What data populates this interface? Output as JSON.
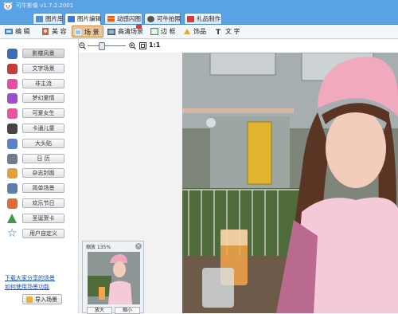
{
  "app": {
    "title": "可牛影像 v1.7.2.2001"
  },
  "tabs": [
    {
      "label": "图片库",
      "icon": "image-library-icon"
    },
    {
      "label": "图片编辑",
      "icon": "image-edit-icon"
    },
    {
      "label": "动感闪图",
      "icon": "flash-image-icon"
    },
    {
      "label": "可牛拍照",
      "icon": "camera-icon"
    },
    {
      "label": "礼品制作",
      "icon": "gift-icon"
    }
  ],
  "toolbar": [
    {
      "label": "编 辑",
      "icon": "edit-icon"
    },
    {
      "label": "美 容",
      "icon": "beauty-icon"
    },
    {
      "label": "场 景",
      "icon": "scene-icon"
    },
    {
      "label": "高清场景",
      "icon": "hd-scene-icon"
    },
    {
      "label": "边 框",
      "icon": "frame-icon"
    },
    {
      "label": "饰品",
      "icon": "accessory-icon"
    },
    {
      "label": "文 字",
      "icon": "text-icon"
    }
  ],
  "categories": [
    {
      "label": "影楼风景",
      "icon": "portrait-icon"
    },
    {
      "label": "文字场景",
      "icon": "text-scene-icon"
    },
    {
      "label": "非主流",
      "icon": "sparkle-icon"
    },
    {
      "label": "梦幻爱情",
      "icon": "heart-icon"
    },
    {
      "label": "可爱女生",
      "icon": "girl-icon"
    },
    {
      "label": "卡通儿童",
      "icon": "cartoon-icon"
    },
    {
      "label": "大头贴",
      "icon": "photo-sticker-icon"
    },
    {
      "label": "日 历",
      "icon": "calendar-icon"
    },
    {
      "label": "杂志封面",
      "icon": "magazine-icon"
    },
    {
      "label": "简单场景",
      "icon": "simple-scene-icon"
    },
    {
      "label": "欢乐节日",
      "icon": "festival-icon"
    },
    {
      "label": "圣诞贺卡",
      "icon": "christmas-tree-icon"
    },
    {
      "label": "用户自定义",
      "icon": "star-icon"
    }
  ],
  "import_button": "导入场景",
  "links": [
    "下载大家分享的场景",
    "如何使用场景功能"
  ],
  "zoom": {
    "ratio_label": "1:1"
  },
  "preview": {
    "zoom_label": "缩放 135%",
    "zoom_in": "放大",
    "zoom_out": "缩小"
  },
  "colors": {
    "titlebar": "#5aa3e4",
    "tab_active": "#ffffff",
    "tool_active": "#eac59a"
  }
}
